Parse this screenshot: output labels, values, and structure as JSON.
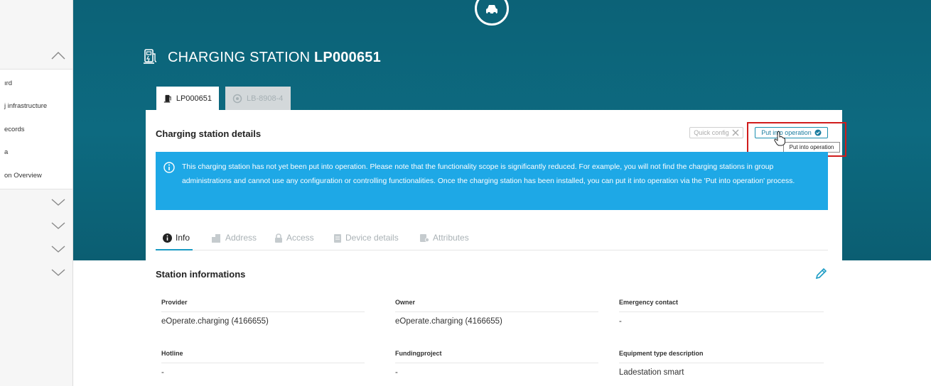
{
  "sidebar": {
    "items": [
      {
        "label": "ırd"
      },
      {
        "label": "j infrastructure"
      },
      {
        "label": "ecords"
      },
      {
        "label": "a"
      },
      {
        "label": "on Overview"
      }
    ]
  },
  "page": {
    "title_prefix": "CHARGING STATION",
    "title_id": "LP000651"
  },
  "tabs": [
    {
      "label": "LP000651",
      "active": true
    },
    {
      "label": "LB-8908-4",
      "active": false
    }
  ],
  "card": {
    "title": "Charging station details",
    "quick_config_label": "Quick config",
    "put_into_operation_label": "Put into operation",
    "tooltip": "Put into operation",
    "info_banner": "This charging station has not yet been put into operation. Please note that the functionality scope is significantly reduced. For example, you will not find the charging stations in group administrations and cannot use any configuration or controlling functionalities. Once the charging station has been installed, you can put it into operation via the 'Put into operation' process."
  },
  "subtabs": [
    {
      "label": "Info",
      "icon": "info-icon",
      "active": true
    },
    {
      "label": "Address",
      "icon": "building-icon",
      "active": false
    },
    {
      "label": "Access",
      "icon": "lock-icon",
      "active": false
    },
    {
      "label": "Device details",
      "icon": "document-icon",
      "active": false
    },
    {
      "label": "Attributes",
      "icon": "attributes-icon",
      "active": false
    }
  ],
  "station": {
    "section_title": "Station informations",
    "fields": [
      {
        "label": "Provider",
        "value": "eOperate.charging (4166655)"
      },
      {
        "label": "Owner",
        "value": "eOperate.charging (4166655)"
      },
      {
        "label": "Emergency contact",
        "value": "-"
      },
      {
        "label": "Hotline",
        "value": "-"
      },
      {
        "label": "Fundingproject",
        "value": "-"
      },
      {
        "label": "Equipment type description",
        "value": "Ladestation smart"
      }
    ]
  },
  "colors": {
    "header": "#0c6277",
    "banner": "#1ea8e6",
    "accent": "#1a9bc4",
    "highlight": "#d01c1c"
  }
}
